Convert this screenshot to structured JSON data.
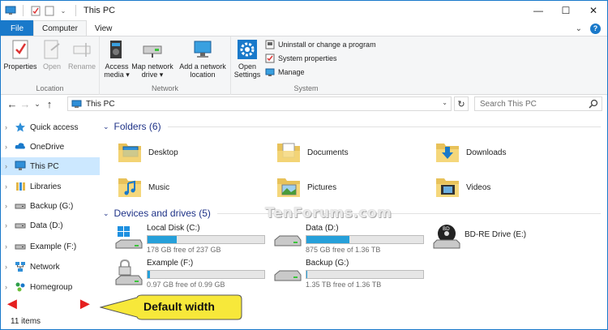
{
  "window": {
    "title": "This PC",
    "buttons": {
      "minimize": "—",
      "maximize": "☐",
      "close": "✕"
    }
  },
  "tabs": {
    "file": "File",
    "computer": "Computer",
    "view": "View",
    "collapse": "⌄",
    "help": "?"
  },
  "ribbon": {
    "location": {
      "label": "Location",
      "properties": "Properties",
      "open": "Open",
      "rename": "Rename"
    },
    "network": {
      "label": "Network",
      "access_media_1": "Access",
      "access_media_2": "media ▾",
      "map_drive_1": "Map network",
      "map_drive_2": "drive ▾",
      "add_location_1": "Add a network",
      "add_location_2": "location"
    },
    "system": {
      "label": "System",
      "open_settings_1": "Open",
      "open_settings_2": "Settings",
      "uninstall": "Uninstall or change a program",
      "system_properties": "System properties",
      "manage": "Manage"
    }
  },
  "navbar": {
    "back": "←",
    "forward": "→",
    "recent": "⌄",
    "up": "↑",
    "address": "This PC",
    "dropdown": "⌄",
    "refresh": "↻",
    "search_placeholder": "Search This PC"
  },
  "nav_items": [
    {
      "label": "Quick access",
      "chev": "›"
    },
    {
      "label": "OneDrive",
      "chev": "›"
    },
    {
      "label": "This PC",
      "chev": "›"
    },
    {
      "label": "Libraries",
      "chev": "›"
    },
    {
      "label": "Backup (G:)",
      "chev": "›"
    },
    {
      "label": "Data (D:)",
      "chev": "›"
    },
    {
      "label": "Example (F:)",
      "chev": "›"
    },
    {
      "label": "Network",
      "chev": "›"
    },
    {
      "label": "Homegroup",
      "chev": "›"
    }
  ],
  "folders_section": {
    "title": "Folders (6)",
    "chev": "⌄"
  },
  "folders": [
    {
      "name": "Desktop"
    },
    {
      "name": "Documents"
    },
    {
      "name": "Downloads"
    },
    {
      "name": "Music"
    },
    {
      "name": "Pictures"
    },
    {
      "name": "Videos"
    }
  ],
  "drives_section": {
    "title": "Devices and drives (5)",
    "chev": "⌄"
  },
  "drives": [
    {
      "name": "Local Disk (C:)",
      "free": "178 GB free of 237 GB",
      "used_fraction": 0.25,
      "bar_color": "#26a0da"
    },
    {
      "name": "Data (D:)",
      "free": "875 GB free of 1.36 TB",
      "used_fraction": 0.37,
      "bar_color": "#26a0da"
    },
    {
      "name": "BD-RE Drive (E:)",
      "free": "",
      "used_fraction": null,
      "bar_color": ""
    },
    {
      "name": "Example (F:)",
      "free": "0.97 GB free of 0.99 GB",
      "used_fraction": 0.02,
      "bar_color": "#26a0da"
    },
    {
      "name": "Backup (G:)",
      "free": "1.35 TB free of 1.36 TB",
      "used_fraction": 0.01,
      "bar_color": "#26a0da"
    }
  ],
  "status": {
    "items": "11 items"
  },
  "watermark": "TenForums.com",
  "annotation": {
    "callout": "Default width",
    "arrow_left": "◄",
    "arrow_right": "►"
  },
  "colors": {
    "accent": "#1979ca",
    "selection": "#cce8ff",
    "callout_fill": "#f7e83a",
    "arrow": "#e51f1f"
  }
}
